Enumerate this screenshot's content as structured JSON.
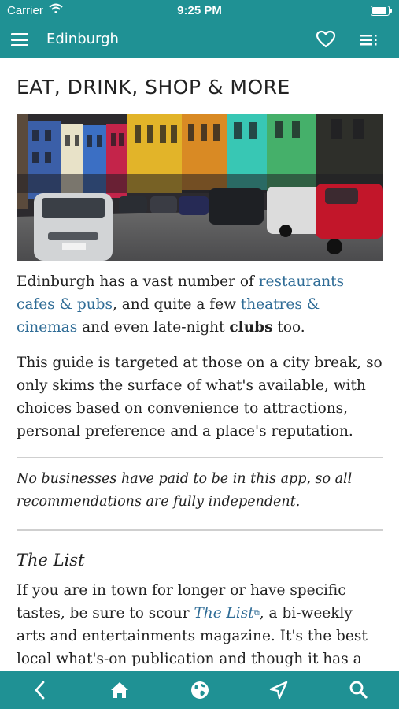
{
  "status": {
    "carrier": "Carrier",
    "time": "9:25 PM",
    "battery_level": 1.0
  },
  "nav": {
    "title": "Edinburgh"
  },
  "page": {
    "title": "EAT, DRINK, SHOP & MORE",
    "p1": {
      "t1": "Edinburgh has a vast number of ",
      "link1": "restaurants cafes & pubs",
      "t2": ", and quite a few ",
      "link2": "theatres & cinemas",
      "t3": " and even late-night ",
      "bold": "clubs",
      "t4": " too."
    },
    "p2": "This guide is targeted at those on a city break, so only skims the surface of what's available, with choices based on convenience to attractions, personal preference and a place's reputation.",
    "note": "No businesses have paid to be in this app, so all recommendations are fully independent.",
    "subhead": "The List",
    "p3": {
      "t1": "If you are in town for longer or have specific tastes, be sure to scour ",
      "link": "The List",
      "ext": "⧉",
      "t2": ", a bi-weekly arts and entertainments magazine. It's the best local what's-on publication and though it has a great website"
    }
  },
  "tabs": [
    {
      "name": "back",
      "icon": "back-chevron-icon"
    },
    {
      "name": "home",
      "icon": "home-icon"
    },
    {
      "name": "web",
      "icon": "globe-icon"
    },
    {
      "name": "nearby",
      "icon": "location-arrow-icon"
    },
    {
      "name": "search",
      "icon": "search-icon"
    }
  ],
  "colors": {
    "brand": "#1f9194",
    "link": "#2f6c96",
    "divider": "#cfcfcf"
  }
}
